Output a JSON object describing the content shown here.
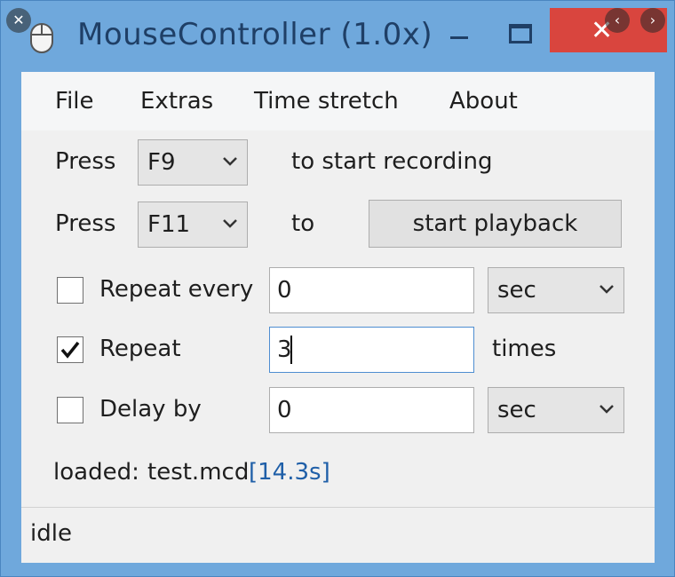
{
  "window": {
    "title": "MouseController (1.0x)",
    "close_glyph": "✕",
    "titlebar_color": "#6fa8dc",
    "close_color": "#d9453e"
  },
  "overlay": {
    "close_glyph": "✕",
    "prev_glyph": "‹",
    "next_glyph": "›"
  },
  "menu": [
    "File",
    "Extras",
    "Time stretch",
    "About"
  ],
  "recording": {
    "prefix": "Press",
    "hotkey": "F9",
    "suffix": "to start recording"
  },
  "playback": {
    "prefix": "Press",
    "hotkey": "F11",
    "suffix": "to",
    "button_label": "start playback"
  },
  "repeat_every": {
    "checked": false,
    "label": "Repeat every",
    "value": "0",
    "unit": "sec"
  },
  "repeat": {
    "checked": true,
    "label": "Repeat",
    "value": "3",
    "unit": "times"
  },
  "delay_by": {
    "checked": false,
    "label": "Delay by",
    "value": "0",
    "unit": "sec"
  },
  "loaded": {
    "label": "loaded:",
    "file": "test.mcd",
    "duration": "[14.3s]",
    "duration_color": "#1f5fa8"
  },
  "status": {
    "text": "idle"
  },
  "icons": [
    "mouse-icon",
    "minimize-icon",
    "maximize-icon",
    "close-icon",
    "chevron-down-icon",
    "checkmark-icon"
  ]
}
